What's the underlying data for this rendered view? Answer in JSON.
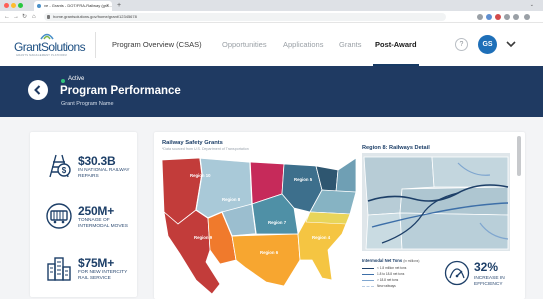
{
  "browser": {
    "tab_title": "ve - Grants - DOT/FRA-Railway (gra...",
    "url": "home.grantsolutions.gov/home/grant/12345678",
    "traffic_lights": [
      "#ff5f57",
      "#febc2e",
      "#28c840"
    ]
  },
  "header": {
    "logo_text": "GrantSolutions",
    "logo_tagline": "GRANTS MANAGEMENT PLATFORM",
    "nav": [
      {
        "label": "Program Overview (CSAS)"
      },
      {
        "label": "Opportunities"
      },
      {
        "label": "Applications"
      },
      {
        "label": "Grants"
      },
      {
        "label": "Post-Award"
      }
    ],
    "help_label": "?",
    "avatar_initials": "GS"
  },
  "banner": {
    "status": "Active",
    "title": "Program Performance",
    "subtitle": "Grant Program Name",
    "background": "#1f3a62",
    "status_color": "#31c27c"
  },
  "stats": [
    {
      "value": "$30.3B",
      "label": "IN NATIONAL RAILWAY REPAIRS",
      "icon": "rail-dollar-icon"
    },
    {
      "value": "250M+",
      "label": "TONNAGE OF INTERMODAL MOVES",
      "icon": "freight-car-icon"
    },
    {
      "value": "$75M+",
      "label": "FOR NEW INTERCITY RAIL SERVICE",
      "icon": "city-buildings-icon"
    }
  ],
  "map": {
    "title": "Railway Safety Grants",
    "source": "*Data sourced from U.S. Department of Transportation",
    "region_labels": [
      "Region 10",
      "Region 8",
      "Region 5",
      "Region 7",
      "Region 9",
      "Region 6",
      "Region 4"
    ],
    "detail_title": "Region 8: Railways Detail",
    "legend_title": "Intermodal Net Tons",
    "legend_unit": "(in millions)",
    "legend_items": [
      {
        "label": "< 1.8 million net tons",
        "color": "#1d3f68"
      },
      {
        "label": "1.8 to 18.8 net tons",
        "color": "#3d6fa8"
      },
      {
        "label": "> 18.8 net tons",
        "color": "#7fa6cf"
      },
      {
        "label": "New railways",
        "color": "#b9cde3"
      }
    ]
  },
  "efficiency": {
    "value": "32%",
    "label": "INCREASE IN EFFICIENCY"
  }
}
